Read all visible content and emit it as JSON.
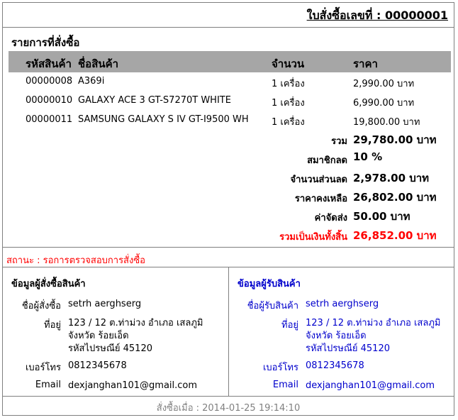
{
  "order": {
    "number_label": "ใบสั่งซื้อเลขที่ : 00000001"
  },
  "items_section": {
    "title": "รายการที่สั่งซื้อ",
    "headers": {
      "code": "รหัสสินค้า",
      "name": "ชื่อสินค้า",
      "qty": "จำนวน",
      "price": "ราคา"
    },
    "rows": [
      {
        "code": "00000008",
        "name": "A369i",
        "qty": "1 เครื่อง",
        "price": "2,990.00 บาท"
      },
      {
        "code": "00000010",
        "name": "GALAXY ACE 3 GT-S7270T WHITE",
        "qty": "1 เครื่อง",
        "price": "6,990.00 บาท"
      },
      {
        "code": "00000011",
        "name": "SAMSUNG GALAXY S IV GT-I9500 WH",
        "qty": "1 เครื่อง",
        "price": "19,800.00 บาท"
      }
    ]
  },
  "summary": {
    "subtotal": {
      "label": "รวม",
      "value": "29,780.00 บาท"
    },
    "member_discount": {
      "label": "สมาชิกลด",
      "value": "10 %"
    },
    "discount_amount": {
      "label": "จำนวนส่วนลด",
      "value": "2,978.00 บาท"
    },
    "remaining": {
      "label": "ราคาคงเหลือ",
      "value": "26,802.00 บาท"
    },
    "shipping": {
      "label": "ค่าจัดส่ง",
      "value": "50.00 บาท"
    },
    "total": {
      "label": "รวมเป็นเงินทั้งสิ้น",
      "value": "26,852.00 บาท"
    }
  },
  "status": "สถานะ : รอการตรวจสอบการสั่งซื้อ",
  "buyer": {
    "title": "ข้อมูลผู้สั่งซื้อสินค้า",
    "name_label": "ชื่อผู้สั่งซื้อ",
    "name": "setrh aerghserg",
    "address_label": "ที่อยู่",
    "address_line1": "123 / 12 ต.ท่าม่วง อำเภอ เสลภูมิ",
    "address_line2": "จังหวัด ร้อยเอ็ด",
    "address_line3": "รหัสไปรษณีย์ 45120",
    "phone_label": "เบอร์โทร",
    "phone": "0812345678",
    "email_label": "Email",
    "email": "dexjanghan101@gmail.com"
  },
  "receiver": {
    "title": "ข้อมูลผู้รับสินค้า",
    "name_label": "ชื่อผู้รับสินค้า",
    "name": "setrh aerghserg",
    "address_label": "ที่อยู่",
    "address_line1": "123 / 12 ต.ท่าม่วง อำเภอ เสลภูมิ",
    "address_line2": "จังหวัด ร้อยเอ็ด",
    "address_line3": "รหัสไปรษณีย์ 45120",
    "phone_label": "เบอร์โทร",
    "phone": "0812345678",
    "email_label": "Email",
    "email": "dexjanghan101@gmail.com"
  },
  "footer": "สั่งซื้อเมื่อ : 2014-01-25 19:14:10",
  "colors": {
    "header_bg": "#a6a6a6",
    "total": "#ff0000",
    "receiver_text": "#0000cc",
    "border": "#7f7f7f"
  }
}
